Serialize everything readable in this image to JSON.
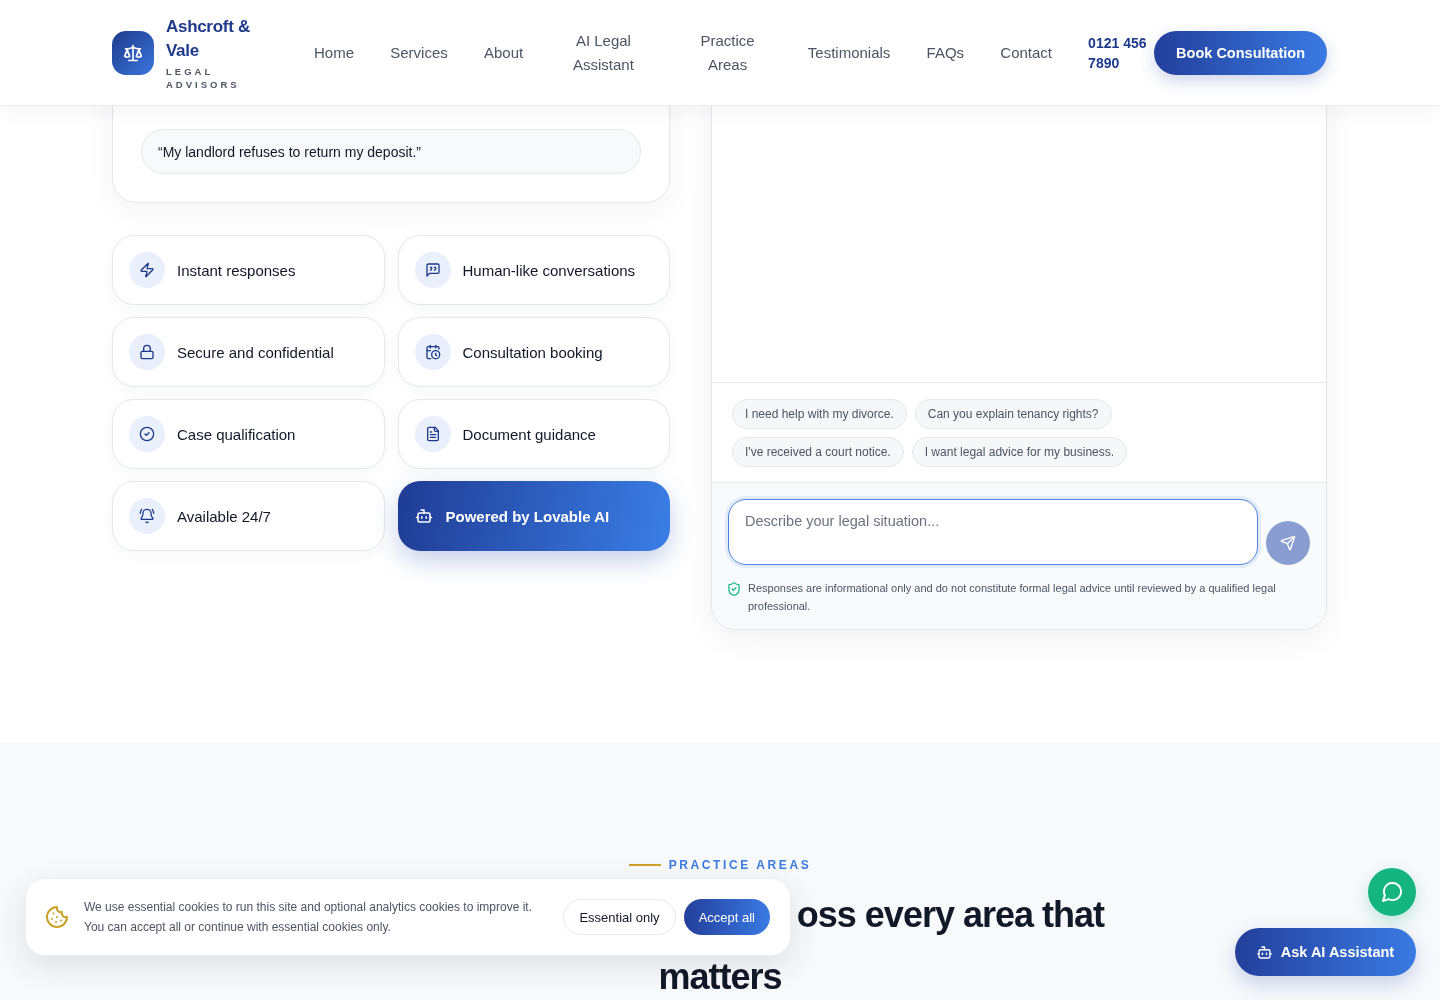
{
  "header": {
    "brand": {
      "name": "Ashcroft & Vale",
      "tagline": "LEGAL ADVISORS"
    },
    "nav": [
      "Home",
      "Services",
      "About",
      "AI Legal Assistant",
      "Practice Areas",
      "Testimonials",
      "FAQs",
      "Contact"
    ],
    "phone": "0121 456 7890",
    "cta": "Book Consultation"
  },
  "prompt_card": {
    "examples": [
      "“My landlord refuses to return my deposit.”"
    ]
  },
  "features": [
    {
      "label": "Instant responses",
      "kind": "standard"
    },
    {
      "label": "Human-like conversations",
      "kind": "standard"
    },
    {
      "label": "Secure and confidential",
      "kind": "standard"
    },
    {
      "label": "Consultation booking",
      "kind": "standard"
    },
    {
      "label": "Case qualification",
      "kind": "standard"
    },
    {
      "label": "Document guidance",
      "kind": "standard"
    },
    {
      "label": "Available 24/7",
      "kind": "standard"
    },
    {
      "label": "Powered by Lovable AI",
      "kind": "highlight"
    }
  ],
  "chat": {
    "suggestions": [
      "I need help with my divorce.",
      "Can you explain tenancy rights?",
      "I've received a court notice.",
      "I want legal advice for my business."
    ],
    "input": {
      "placeholder": "Describe your legal situation..."
    },
    "disclaimer": "Responses are informational only and do not constitute formal legal advice until reviewed by a qualified legal professional."
  },
  "practice_areas": {
    "eyebrow": "PRACTICE AREAS",
    "heading_lines": [
      "oss every area that",
      "matters"
    ]
  },
  "cookie_banner": {
    "text": "We use essential cookies to run this site and optional analytics cookies to improve it. You can accept all or continue with essential cookies only.",
    "buttons": [
      {
        "label": "Essential only",
        "kind": "secondary"
      },
      {
        "label": "Accept all",
        "kind": "primary"
      }
    ]
  },
  "floating": {
    "assistant_button": "Ask AI Assistant"
  }
}
